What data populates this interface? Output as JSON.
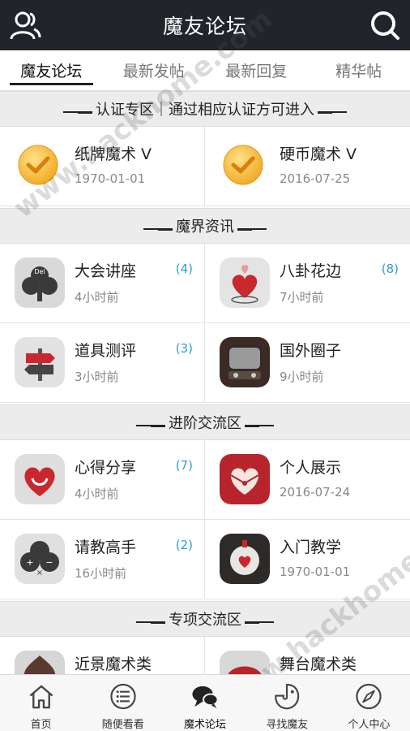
{
  "header": {
    "title": "魔友论坛"
  },
  "tabs": [
    {
      "label": "魔友论坛",
      "active": true
    },
    {
      "label": "最新发帖",
      "active": false
    },
    {
      "label": "最新回复",
      "active": false
    },
    {
      "label": "精华帖",
      "active": false
    }
  ],
  "sections": [
    {
      "title": "认证专区｜通过相应认证方可进入",
      "items": [
        {
          "name": "纸牌魔术 V",
          "time": "1970-01-01",
          "count": "",
          "icon": "check-badge-icon"
        },
        {
          "name": "硬币魔术 V",
          "time": "2016-07-25",
          "count": "",
          "icon": "check-badge-icon"
        }
      ]
    },
    {
      "title": "魔界资讯",
      "items": [
        {
          "name": "大会讲座",
          "time": "4小时前",
          "count": "(4)",
          "icon": "club-del-icon"
        },
        {
          "name": "八卦花边",
          "time": "7小时前",
          "count": "(8)",
          "icon": "hearts-icon"
        },
        {
          "name": "道具测评",
          "time": "3小时前",
          "count": "(3)",
          "icon": "signpost-icon"
        },
        {
          "name": "国外圈子",
          "time": "9小时前",
          "count": "",
          "icon": "tv-icon"
        }
      ]
    },
    {
      "title": "进阶交流区",
      "items": [
        {
          "name": "心得分享",
          "time": "4小时前",
          "count": "(7)",
          "icon": "heart-smile-icon"
        },
        {
          "name": "个人展示",
          "time": "2016-07-24",
          "count": "",
          "icon": "heart-envelope-icon"
        },
        {
          "name": "请教高手",
          "time": "16小时前",
          "count": "(2)",
          "icon": "club-calculator-icon"
        },
        {
          "name": "入门教学",
          "time": "1970-01-01",
          "count": "",
          "icon": "heart-card-icon"
        }
      ]
    },
    {
      "title": "专项交流区",
      "items": [
        {
          "name": "近景魔术类",
          "time": "",
          "count": "",
          "icon": "spade-hat-icon"
        },
        {
          "name": "舞台魔术类",
          "time": "",
          "count": "",
          "icon": "red-umbrella-icon"
        }
      ]
    }
  ],
  "bottom_nav": [
    {
      "label": "首页",
      "icon": "home-icon",
      "active": false
    },
    {
      "label": "随便看看",
      "icon": "list-icon",
      "active": false
    },
    {
      "label": "魔术论坛",
      "icon": "chat-bubbles-icon",
      "active": true
    },
    {
      "label": "寻找魔友",
      "icon": "find-friend-icon",
      "active": false
    },
    {
      "label": "个人中心",
      "icon": "compass-icon",
      "active": false
    }
  ],
  "watermark": "www.hackhome.com"
}
